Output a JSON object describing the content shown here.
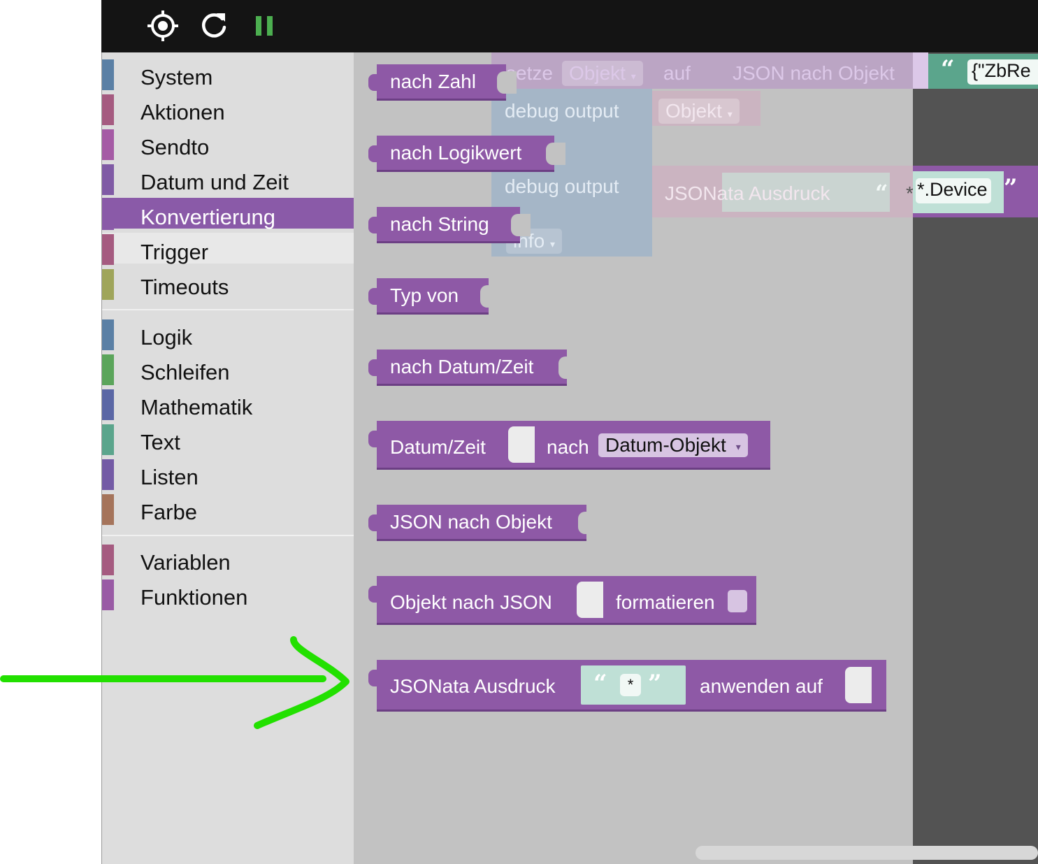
{
  "toolbar": {
    "buttons": [
      {
        "name": "target-icon",
        "label": "Zentrieren"
      },
      {
        "name": "refresh-icon",
        "label": "Neu laden"
      },
      {
        "name": "pause-icon",
        "label": "Pause"
      }
    ],
    "pause_color": "#4caf50"
  },
  "toolbox": {
    "categories": [
      {
        "label": "System",
        "color": "#5b80a5"
      },
      {
        "label": "Aktionen",
        "color": "#a55b80"
      },
      {
        "label": "Sendto",
        "color": "#a55ba5"
      },
      {
        "label": "Datum und Zeit",
        "color": "#805ba5"
      },
      {
        "label": "Konvertierung",
        "color": "#8a5aa8",
        "selected": true
      },
      {
        "label": "Trigger",
        "color": "#a55b80"
      },
      {
        "label": "Timeouts",
        "color": "#9fa55b"
      },
      {
        "label": "Logik",
        "color": "#5b80a5"
      },
      {
        "label": "Schleifen",
        "color": "#5ba55b"
      },
      {
        "label": "Mathematik",
        "color": "#5b67a5"
      },
      {
        "label": "Text",
        "color": "#5ba58c"
      },
      {
        "label": "Listen",
        "color": "#745ba5"
      },
      {
        "label": "Farbe",
        "color": "#a5745b"
      },
      {
        "label": "Variablen",
        "color": "#a55b80"
      },
      {
        "label": "Funktionen",
        "color": "#995ba5"
      }
    ]
  },
  "flyout": {
    "blocks": {
      "to_number": "nach Zahl",
      "to_boolean": "nach Logikwert",
      "to_string": "nach String",
      "type_of": "Typ von",
      "to_datetime": "nach Datum/Zeit",
      "datetime_a": "Datum/Zeit",
      "datetime_b": "nach",
      "datetime_dropdown": "Datum-Objekt",
      "json_to_object": "JSON nach Objekt",
      "object_to_json": "Objekt nach JSON",
      "format_label": "formatieren",
      "jsonata_a": "JSONata Ausdruck",
      "jsonata_value": "*",
      "jsonata_b": "anwenden auf"
    },
    "ghost": {
      "set": "setze",
      "obj_dropdown": "Objekt",
      "to": "auf",
      "json_to_object": "JSON nach Objekt",
      "debug1": "debug output",
      "debug1_dropdown": "Objekt",
      "debug2": "debug output",
      "jsonata": "JSONata Ausdruck",
      "jsonata_value": "*.Device",
      "info_dropdown": "info",
      "string_value": "{\"ZbRe"
    }
  },
  "quote_open": "“",
  "quote_close": "”",
  "dropdown_arrow": "▾",
  "annotation_color": "#22e000"
}
